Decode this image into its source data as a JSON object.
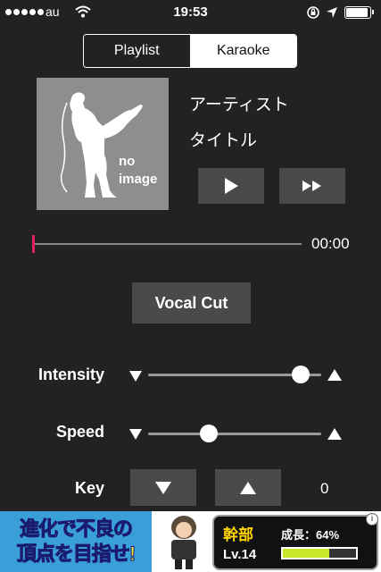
{
  "status_bar": {
    "carrier": "au",
    "time": "19:53"
  },
  "segments": {
    "playlist": "Playlist",
    "karaoke": "Karaoke",
    "selected": "Karaoke"
  },
  "artwork": {
    "line1": "no",
    "line2": "image"
  },
  "track": {
    "artist": "アーティスト",
    "title": "タイトル"
  },
  "player": {
    "elapsed": "00:00",
    "progress": 0
  },
  "vocal_cut": {
    "label": "Vocal Cut"
  },
  "intensity": {
    "label": "Intensity",
    "value": 0.88
  },
  "speed": {
    "label": "Speed",
    "value": 0.35
  },
  "key": {
    "label": "Key",
    "value": "0"
  },
  "ad": {
    "headline_line1": "進化で不良の",
    "headline_line2": "頂点を目指せ!",
    "rank": "幹部",
    "level": "Lv.14",
    "growth": "成長：64%",
    "growth_value": 0.64,
    "info": "i"
  },
  "colors": {
    "background": "#222222",
    "button": "#4a4a4a",
    "progress_marker": "#e0245e",
    "artwork_bg": "#8e8e8e"
  }
}
